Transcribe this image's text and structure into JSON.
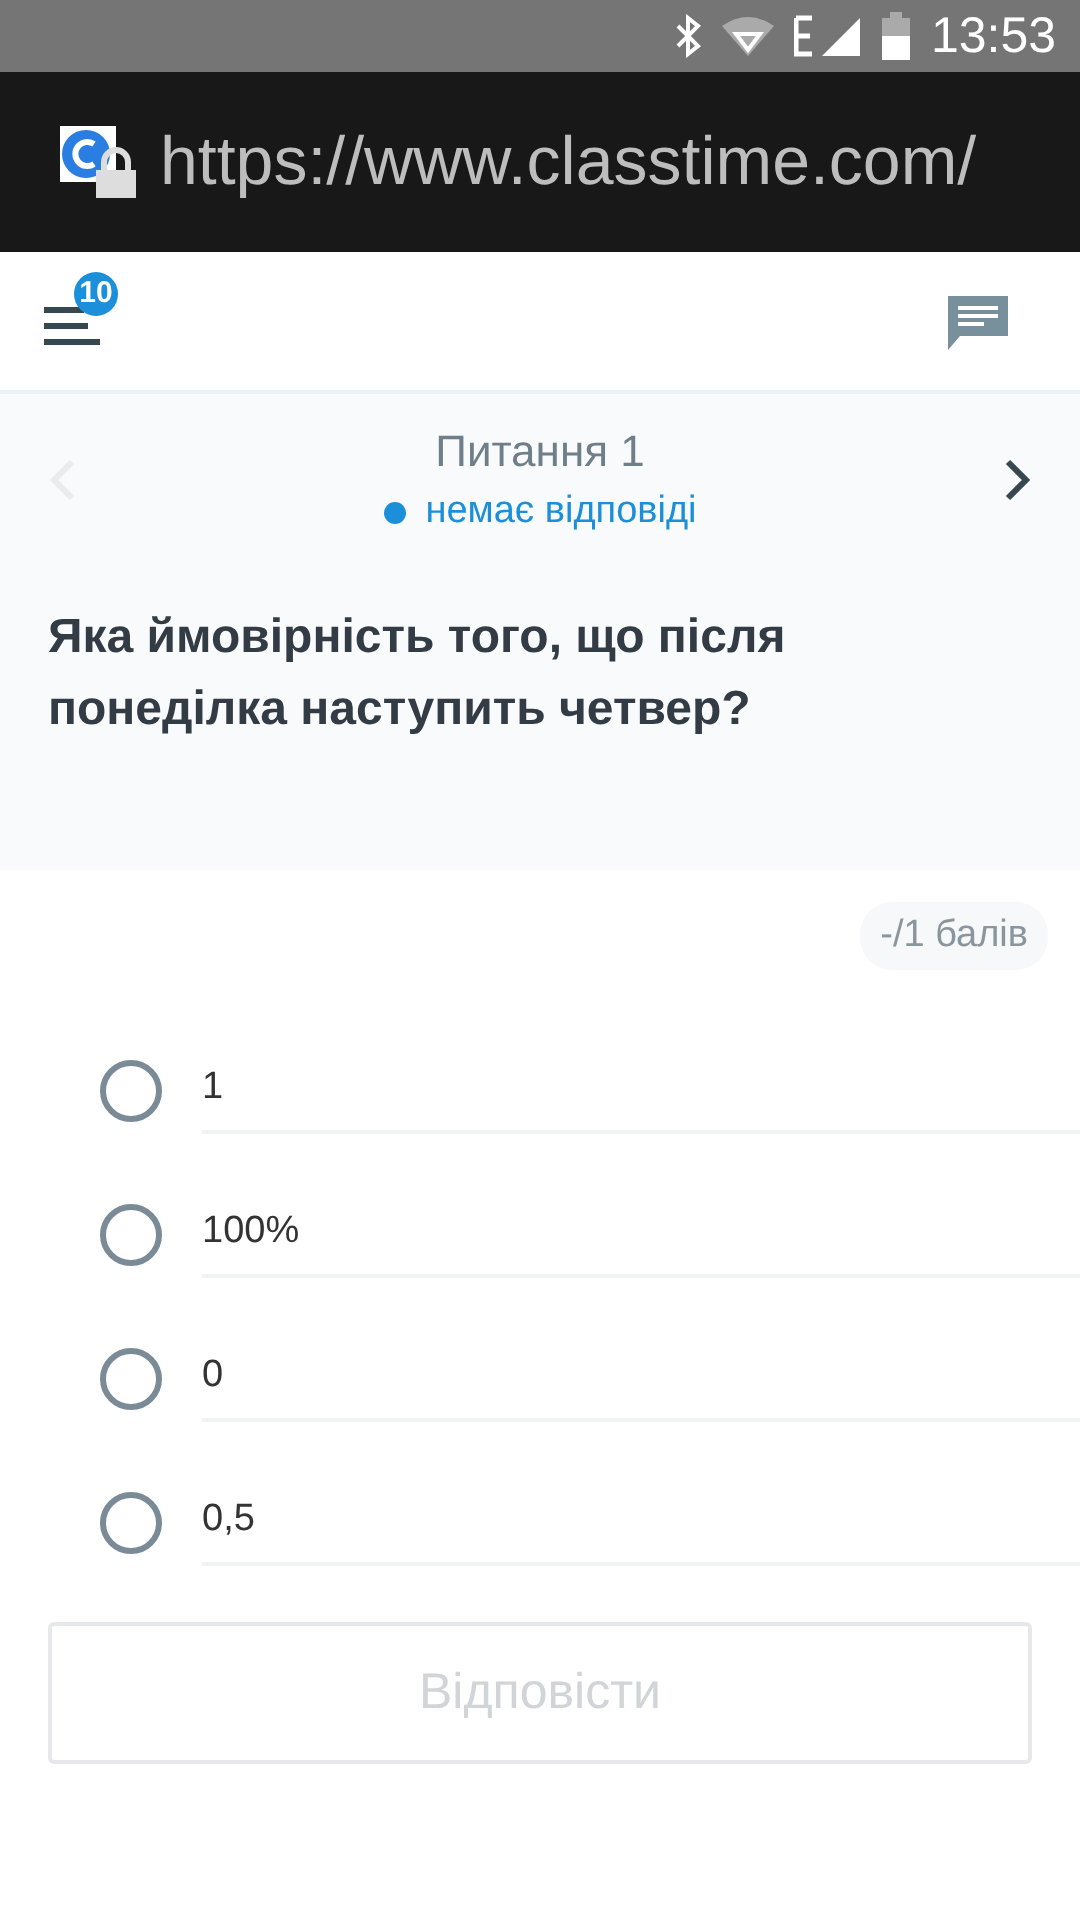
{
  "status_bar": {
    "time": "13:53"
  },
  "browser": {
    "url": "https://www.classtime.com/"
  },
  "header": {
    "badge": "10"
  },
  "question": {
    "title": "Питання 1",
    "status": "немає відповіді",
    "prev_disabled": true,
    "text": "Яка ймовірність того, що після понеділка наступить четвер?",
    "points": "-/1 балів"
  },
  "options": [
    {
      "label": "1",
      "selected": false
    },
    {
      "label": "100%",
      "selected": false
    },
    {
      "label": "0",
      "selected": false
    },
    {
      "label": "0,5",
      "selected": false
    }
  ],
  "submit": {
    "label": "Відповісти",
    "disabled": true
  }
}
